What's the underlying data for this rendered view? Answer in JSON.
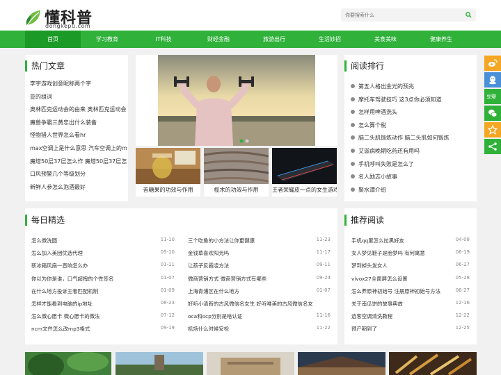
{
  "brand": {
    "name_cn": "懂科普",
    "name_en": "dongkepu.com"
  },
  "search": {
    "placeholder": "你要搜索什么"
  },
  "nav": [
    "首页",
    "学习教育",
    "IT科技",
    "财经金融",
    "旅游出行",
    "生活妙招",
    "美食美味",
    "健康养生"
  ],
  "hot": {
    "title": "热门文章",
    "items": [
      "李宇游戏创意昵称两个字",
      "亚的组词",
      "奥林匹克运动会的由来 奥林匹克运动会",
      "魔兽争霸三黄忠出什么装备",
      "怪物猎人世界怎么看hr",
      "max空调上是什么意思 汽车空调上的max",
      "魔塔50层37层怎么作 魔塔50层37层怎么",
      "口风预警几个等级划分",
      "新鲜人参怎么泡酒最好"
    ]
  },
  "thumbs": [
    {
      "caption": "苦糖果的功效与作用"
    },
    {
      "caption": "榄木的功效与作用"
    },
    {
      "caption": "王者荣耀皮一点的女生游戏"
    }
  ],
  "rank": {
    "title": "阅读排行",
    "items": [
      "第五人格出金光的预兆",
      "摩托车驾驶技巧 这3点你必须知道",
      "怎样用啤酒洗头",
      "怎么算个税",
      "脑二头肌锻炼动作 脑二头肌如何锻炼",
      "艾滋病晚期吃药还有用吗",
      "手机呼叫失败是怎么了",
      "名人励志小故事",
      "聚水潭介绍"
    ]
  },
  "daily": {
    "title": "每日精选",
    "col1": [
      {
        "text": "怎么微洗圆",
        "date": "11-10"
      },
      {
        "text": "怎么加入美团优选代理",
        "date": "05-10"
      },
      {
        "text": "新冰箱风扇一直响怎么办",
        "date": "01-11"
      },
      {
        "text": "你以为你是谁，口气超拽的个性签名",
        "date": "01-07"
      },
      {
        "text": "在什么地方投诉王者匹配机制",
        "date": "01-09"
      },
      {
        "text": "怎样才能看到电脑的ip地址",
        "date": "08-23"
      },
      {
        "text": "怎么微心愿卡 微心愿卡的微法",
        "date": "07-12"
      },
      {
        "text": "ncm文件怎么改mp3格式",
        "date": "09-19"
      }
    ],
    "col2": [
      {
        "text": "三个吃鱼的小方法让你更健康",
        "date": "11-23"
      },
      {
        "text": "金钱草喜欢阳光吗",
        "date": "11-17"
      },
      {
        "text": "让孩子反霸凌方法",
        "date": "09-11"
      },
      {
        "text": "微商营销方式 微商营销方式有哪些",
        "date": "09-24"
      },
      {
        "text": "上海青浦区在什么地方",
        "date": "01-07"
      },
      {
        "text": "好听小清新的古风微信名女生 好听唯美的古风微信名女",
        "date": ""
      },
      {
        "text": "oca和ocp分别是啥认证",
        "date": "11-16"
      },
      {
        "text": "机场什么时候安检",
        "date": "11-22"
      }
    ]
  },
  "recommend": {
    "title": "推荐阅读",
    "items": [
      {
        "text": "手机qq里怎么拉黑好友",
        "date": "04-08"
      },
      {
        "text": "女人梦见鞋子是胎梦吗 有何寓意",
        "date": "06-19"
      },
      {
        "text": "梦到掉头发女人",
        "date": "06-27"
      },
      {
        "text": "vivox27全面屏怎么设置",
        "date": "05-28"
      },
      {
        "text": "怎么养原神初始号 注册原神初始号方法",
        "date": "06-27"
      },
      {
        "text": "关于南瓜饼的故事典故",
        "date": "12-16"
      },
      {
        "text": "逍客空调清洗教程",
        "date": "12-22"
      },
      {
        "text": "预产期到了",
        "date": "12-25"
      }
    ]
  },
  "share_icons": [
    "weibo-icon",
    "qq-icon",
    "douban-icon",
    "wechat-icon",
    "favorite-icon",
    "share-icon"
  ],
  "share_labels": {
    "douban": "豆瓣"
  },
  "colors": {
    "brand_green": "#2fb13a",
    "nav_active": "#1c9a27",
    "share_orange": "#f5a623",
    "share_blue": "#4a90d9",
    "share_green": "#2fb13a"
  }
}
